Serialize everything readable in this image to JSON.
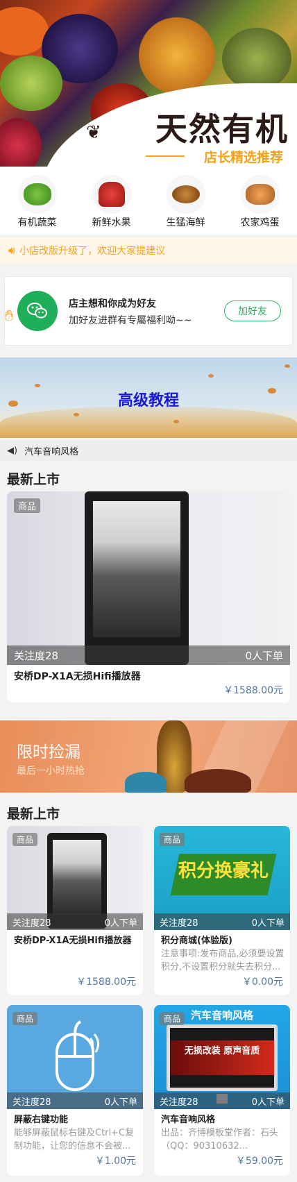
{
  "hero": {
    "title": "天然有机",
    "subtitle": "店长精选推荐"
  },
  "categories": [
    {
      "label": "有机蔬菜",
      "icon": "lettuce-icon",
      "color": "#4ca32a"
    },
    {
      "label": "新鲜水果",
      "icon": "fruit-basket-icon",
      "color": "#d9302c"
    },
    {
      "label": "生猛海鲜",
      "icon": "crayfish-icon",
      "color": "#b96a1d"
    },
    {
      "label": "农家鸡蛋",
      "icon": "eggs-icon",
      "color": "#e08a3a"
    }
  ],
  "notice": {
    "icon": "speaker-icon",
    "text": "小店改版升级了，欢迎大家提建议",
    "color": "#f7a21a"
  },
  "friend_card": {
    "title": "店主想和你成为好友",
    "subtitle": "加好友进群有专屬福利呦~~",
    "button": "加好友",
    "icon": "wechat-icon",
    "accent": "#1fae59"
  },
  "tutorial_banner": {
    "text": "高级教程"
  },
  "audio_bar": {
    "icon": "volume-icon",
    "text": "汽车音响风格"
  },
  "section1": {
    "title": "最新上市",
    "product": {
      "tag": "商品",
      "attention": "关注度28",
      "orders": "0人下单",
      "name": "安桥DP-X1A无损Hifi播放器",
      "price": "￥1588.00元"
    }
  },
  "flash_banner": {
    "title": "限时捡漏",
    "subtitle": "最后一小时热抢"
  },
  "section2": {
    "title": "最新上市",
    "products": [
      {
        "tag": "商品",
        "attention": "关注度28",
        "orders": "0人下单",
        "name": "安桥DP-X1A无损Hifi播放器",
        "desc": "",
        "price": "￥1588.00元",
        "thumb": "player"
      },
      {
        "tag": "商品",
        "attention": "关注度28",
        "orders": "0人下单",
        "name": "积分商城(体验版)",
        "desc": "注意事项:发布商品,必须要设置积分,不设置积分就失去积分...",
        "price": "￥0.00元",
        "thumb": "points",
        "thumb_text": "积分换豪礼"
      },
      {
        "tag": "商品",
        "attention": "关注度28",
        "orders": "0人下单",
        "name": "屏蔽右键功能",
        "desc": "能够屏蔽鼠标右键及Ctrl+C复制功能，让您的信息不会被...",
        "price": "￥1.00元",
        "thumb": "mouse"
      },
      {
        "tag": "商品",
        "attention": "关注度28",
        "orders": "0人下单",
        "name": "汽车音响风格",
        "desc": "出品：齐博模板堂作者：石头（QQ：90310632...",
        "price": "￥59.00元",
        "thumb": "car",
        "thumb_title": "汽车音响风格",
        "thumb_text": "无损改装 原声音质"
      }
    ]
  }
}
